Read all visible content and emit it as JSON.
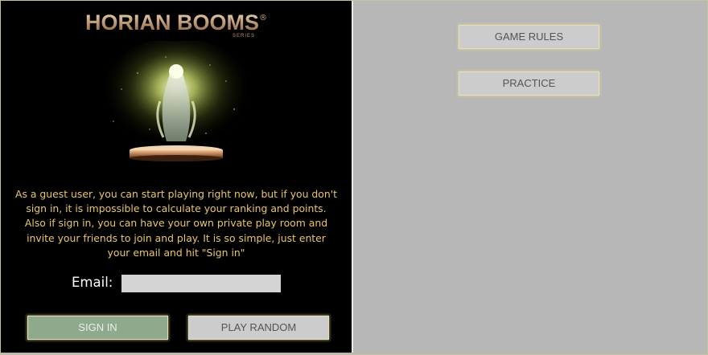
{
  "logo": {
    "title": "HORIAN BOOMS",
    "registered_mark": "®",
    "subtitle": "SERIES"
  },
  "guest_message": "As a guest user, you can start playing right now, but if you don't sign in, it is impossible to calculate your ranking and points. Also if sign in, you can have your own private play room and invite your friends to join and play. It is so simple, just enter your email and hit \"Sign in\"",
  "email": {
    "label": "Email:",
    "value": "",
    "placeholder": ""
  },
  "buttons": {
    "sign_in": "SIGN IN",
    "play_random": "PLAY RANDOM",
    "game_rules": "GAME RULES",
    "practice": "PRACTICE"
  },
  "colors": {
    "guest_text": "#e9c66a",
    "sign_in_bg": "#8fa98d",
    "button_bg": "#cccccc",
    "right_panel_bg": "#b7b7b7",
    "left_panel_bg": "#000000"
  }
}
